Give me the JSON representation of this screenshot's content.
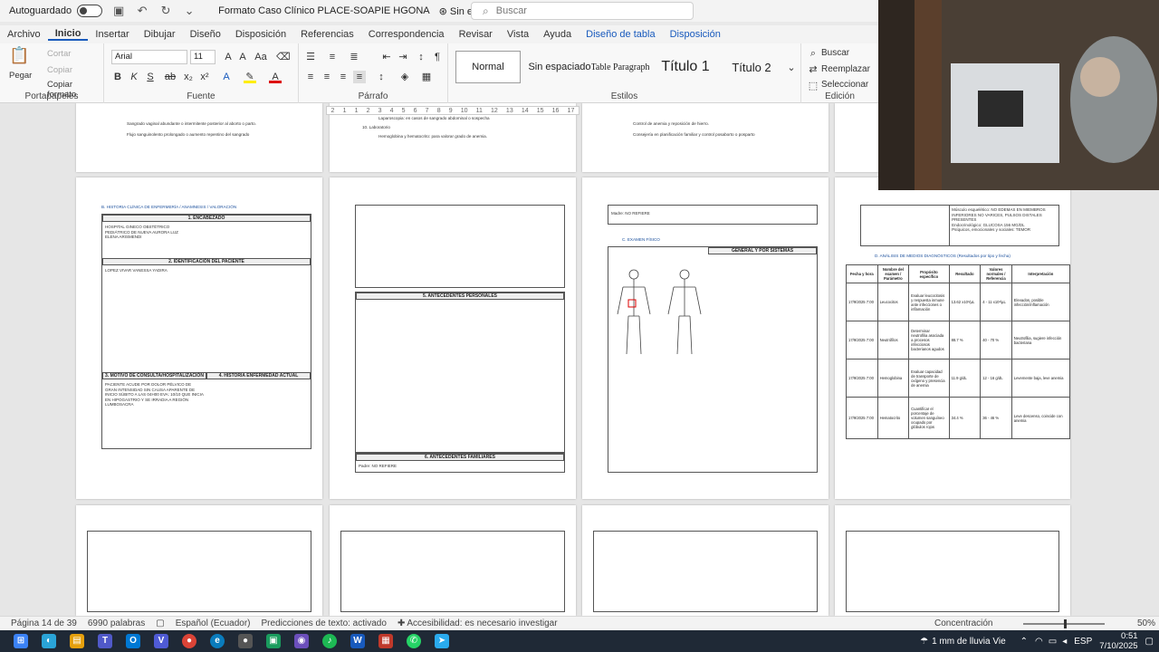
{
  "titlebar": {
    "autosave_label": "Autoguardado",
    "doc_title": "Formato Caso Clínico PLACE-SOAPIE HGONA",
    "label_status": "Sin etiqueta",
    "search_placeholder": "Buscar"
  },
  "tabs": [
    "Archivo",
    "Inicio",
    "Insertar",
    "Dibujar",
    "Diseño",
    "Disposición",
    "Referencias",
    "Correspondencia",
    "Revisar",
    "Vista",
    "Ayuda",
    "Diseño de tabla",
    "Disposición"
  ],
  "ribbon": {
    "clipboard": {
      "paste": "Pegar",
      "cut": "Cortar",
      "copy": "Copiar",
      "format_painter": "Copiar formato",
      "label": "Portapapeles"
    },
    "font": {
      "name": "Arial",
      "size": "11",
      "label": "Fuente"
    },
    "paragraph": {
      "label": "Párrafo"
    },
    "styles": {
      "items": [
        "Normal",
        "Sin espaciado",
        "Table Paragraph",
        "Título 1",
        "Título 2"
      ],
      "label": "Estilos"
    },
    "editing": {
      "find": "Buscar",
      "replace": "Reemplazar",
      "select": "Seleccionar",
      "label": "Edición"
    }
  },
  "ruler_ticks": [
    "2",
    "1",
    "1",
    "2",
    "3",
    "4",
    "5",
    "6",
    "7",
    "8",
    "9",
    "10",
    "11",
    "12",
    "13",
    "14",
    "15",
    "16",
    "17"
  ],
  "pages": {
    "p1_top": [
      "Sangrado vaginal abundante o intermitente posterior al aborto o parto.",
      "Flujo sanguinolento prolongado o aumento repentino del sangrado"
    ],
    "p2_top": [
      "Laparoscopia: en casos de sangrado abdominal o sospecha",
      "10. Laboratorio",
      "Hemoglobina y hematocrito: para valorar grado de anemia."
    ],
    "p3_top": [
      "Control de anemia y reposición de hierro.",
      "Consejería en planificación familiar y control posaborto o posparto"
    ],
    "p4_title": "B. HISTORIA CLÍNICA DE ENFERMERÍA / ANAMNESIS / VALORACIÓN",
    "p4_head1": "1. ENCABEZADO",
    "p4_head2": "2. IDENTIFICACIÓN DEL PACIENTE",
    "p4_head3": "3. MOTIVO DE CONSULTA/HOSPITALIZACIÓN",
    "p4_head4": "4. HISTORIA ENFERMEDAD ACTUAL",
    "p4_institution": "HOSPITAL GINECO OBSTÉTRICO PEDIÁTRICO DE NUEVA AURORA LUZ ELENA ARISMENDI",
    "p4_patient": "LOPEZ VIVAR VANESSA YADIRA",
    "p4_motivo": "PACIENTE ACUDE POR DOLOR PÉLVICO DE GRAN INTENSIDAD SIN CAUSA APARENTE DE INICIO SÚBITO A LAS 04H00 EVA: 10/10 QUE INICIA EN HIPOGASTRIO Y SE IRRADIA A REGIÓN LUMBOSACRA",
    "p5_head": "5. ANTECEDENTES PERSONALES",
    "p5_head2": "6. ANTECEDENTES FAMILIARES",
    "p5_father": "Padre: NO REFIERE",
    "p6_mother": "Madre: NO REFIERE",
    "p6_exam": "C. EXAMEN FÍSICO",
    "p6_general": "GENERAL Y POR SISTEMAS",
    "p7_title": "D. ANÁLISIS DE MEDIOS DIAGNÓSTICOS (Resultados por tipo y fecha)",
    "p7_headers": [
      "Fecha y hora",
      "Nombre del examen / Parámetro",
      "Propósito específico",
      "Resultado",
      "Valores normales / Referencia",
      "Interpretación"
    ],
    "p7_rows": [
      [
        "17/9/2025 7:00",
        "Leucocitos",
        "Evaluar leucocitosis y respuesta inmune ante infecciones o inflamación",
        "13.62 x10³/µL",
        "4 - 11 x10³/µL",
        "Elevados, posible infección/inflamación"
      ],
      [
        "17/9/2025 7:00",
        "Neutrófilos",
        "Determinar neutrofilia asociada a procesos infecciosos bacterianos agudos",
        "88.7 %",
        "40 - 70 %",
        "Neutrofilia, sugiere infección bacteriana"
      ],
      [
        "17/9/2025 7:00",
        "Hemoglobina",
        "Evaluar capacidad de transporte de oxígeno y presencia de anemia",
        "11.9 g/dL",
        "12 - 16 g/dL",
        "Levemente baja, leve anemia"
      ],
      [
        "17/9/2025 7:00",
        "Hematocrito",
        "Cuantificar el porcentaje de volumen sanguíneo ocupado por glóbulos rojos",
        "34.4 %",
        "36 - 46 %",
        "Leve descenso, coincide con anemia"
      ]
    ],
    "p7_muscle": "Músculo esquelético: NO EDEMAS EN MIEMBROS INFERIORES NO VARICES, PULSOS DISTALES PRESENTES",
    "p7_endo": "Endocrinológico: GLUCOSA 156 MG/DL",
    "p7_psy": "Psíquicos, emocionales y sociales: TEMOR"
  },
  "statusbar": {
    "page": "Página 14 de 39",
    "words": "6990 palabras",
    "lang": "Español (Ecuador)",
    "predict": "Predicciones de texto: activado",
    "access": "Accesibilidad: es necesario investigar",
    "focus": "Concentración",
    "zoom": "50%"
  },
  "taskbar": {
    "weather": "1 mm de lluvia Vie",
    "lang": "ESP",
    "time": "0:51",
    "date": "7/10/2025"
  }
}
